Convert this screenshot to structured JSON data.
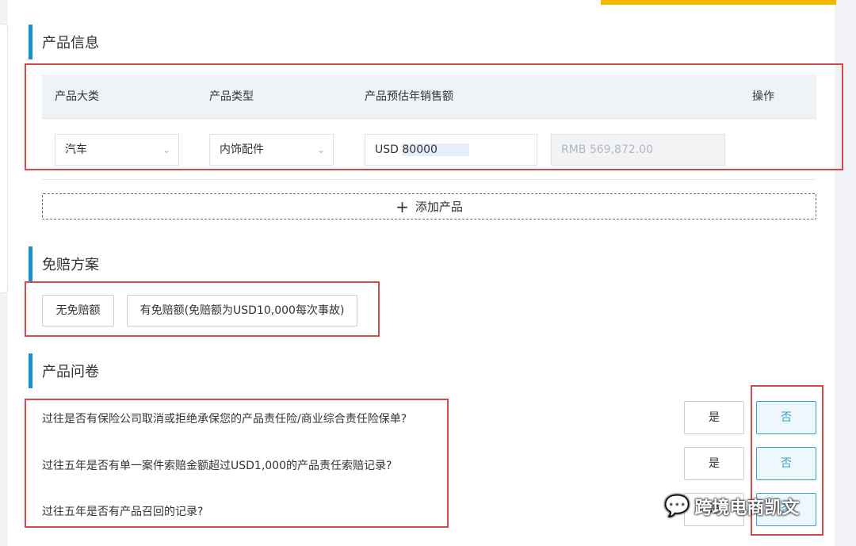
{
  "product_info": {
    "title": "产品信息",
    "headers": [
      "产品大类",
      "产品类型",
      "产品预估年销售额",
      "操作"
    ],
    "row": {
      "category": "汽车",
      "type": "内饰配件",
      "currency_prefix": "USD",
      "amount": "80000",
      "converted": "RMB 569,872.00"
    },
    "add_label": "添加产品"
  },
  "deductible": {
    "title": "免赔方案",
    "options": [
      "无免赔额",
      "有免赔额(免赔额为USD10,000每次事故)"
    ]
  },
  "questionnaire": {
    "title": "产品问卷",
    "questions": [
      "过往是否有保险公司取消或拒绝承保您的产品责任险/商业综合责任险保单?",
      "过往五年是否有单一案件索赔金额超过USD1,000的产品责任索赔记录?",
      "过往五年是否有产品召回的记录?"
    ],
    "yes_label": "是",
    "no_label": "否"
  },
  "watermark": {
    "text": "跨境电商凯文",
    "icon": "wechat-icon"
  },
  "colors": {
    "accent_blue": "#1a8fcf",
    "highlight_red": "#d24a4a",
    "top_accent": "#f5b800",
    "selected_no": "#3aa0c8"
  }
}
